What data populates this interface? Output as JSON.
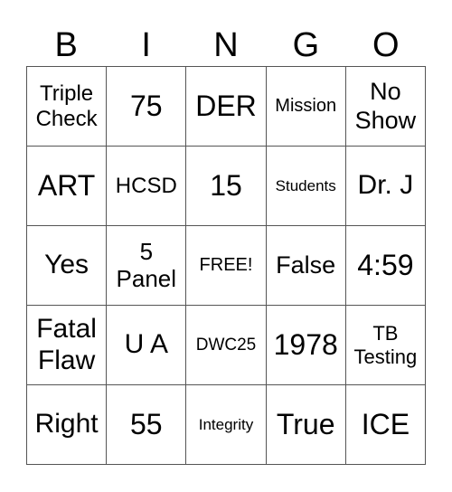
{
  "header": [
    "B",
    "I",
    "N",
    "G",
    "O"
  ],
  "cells": [
    [
      "Triple Check",
      "75",
      "DER",
      "Mission",
      "No Show"
    ],
    [
      "ART",
      "HCSD",
      "15",
      "Students",
      "Dr. J"
    ],
    [
      "Yes",
      "5 Panel",
      "FREE!",
      "False",
      "4:59"
    ],
    [
      "Fatal Flaw",
      "U A",
      "DWC25",
      "1978",
      "TB Testing"
    ],
    [
      "Right",
      "55",
      "Integrity",
      "True",
      "ICE"
    ]
  ]
}
